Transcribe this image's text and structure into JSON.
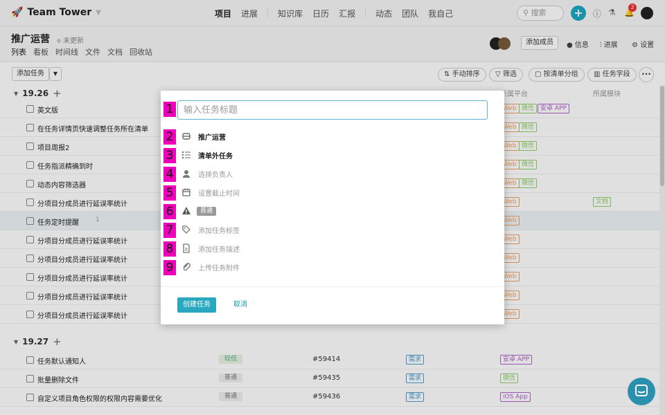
{
  "app": {
    "title": "Team Tower",
    "notif_count": "2"
  },
  "nav": {
    "items": [
      "项目",
      "进展",
      "知识库",
      "日历",
      "汇报",
      "动态",
      "团队",
      "我自己"
    ]
  },
  "search": {
    "placeholder": "搜索"
  },
  "project": {
    "title": "推广运营",
    "status": "未更新",
    "tabs": [
      "列表",
      "看板",
      "时间线",
      "文件",
      "文档",
      "回收站"
    ],
    "add_member": "添加成员",
    "info": "信息",
    "progress": "进展",
    "settings": "设置"
  },
  "toolbar": {
    "add_task": "添加任务",
    "sort": "手动排序",
    "filter": "筛选",
    "group": "按清单分组",
    "fields": "任务字段"
  },
  "columns": {
    "module": "所属模块",
    "platform": "所属平台"
  },
  "groups": [
    {
      "name": "19.26"
    },
    {
      "name": "19.27"
    }
  ],
  "rows1926": [
    {
      "title": "英文版",
      "tags": [
        "Web",
        "微信",
        "安卓 APP"
      ]
    },
    {
      "title": "在任务详情页快速调整任务所在清单",
      "tags": [
        "Web",
        "微信"
      ]
    },
    {
      "title": "项目周报2",
      "tags": [
        "Web",
        "微信"
      ]
    },
    {
      "title": "任务指派精确到时",
      "tags": [
        "Web",
        "微信"
      ]
    },
    {
      "title": "动态内容筛选器",
      "tags": [
        "Web",
        "微信"
      ]
    },
    {
      "title": "分项目分成员进行延误率统计",
      "tags": [
        "Web"
      ],
      "module": "文档"
    },
    {
      "title": "任务定时提醒",
      "tags": [
        "Web"
      ],
      "comments": "1"
    },
    {
      "title": "分项目分成员进行延误率统计",
      "tags": [
        "Web"
      ]
    },
    {
      "title": "分项目分成员进行延误率统计",
      "tags": [
        "Web"
      ]
    },
    {
      "title": "分项目分成员进行延误率统计",
      "tags": [
        "Web"
      ]
    },
    {
      "title": "分项目分成员进行延误率统计",
      "tags": [
        "Web"
      ]
    },
    {
      "title": "分项目分成员进行延误率统计",
      "tags": [
        "Web"
      ]
    }
  ],
  "rows1927": [
    {
      "title": "任务默认通知人",
      "priority": "较低",
      "id": "#59414",
      "type": "需求",
      "platform": "安卓 APP"
    },
    {
      "title": "批量删除文件",
      "priority": "普通",
      "id": "#59435",
      "type": "需求",
      "platform": "微信"
    },
    {
      "title": "自定义项目角色权限的权限内容需要优化",
      "priority": "普通",
      "id": "#59436",
      "type": "需求",
      "platform": "iOS App"
    }
  ],
  "modal": {
    "title_placeholder": "输入任务标题",
    "project": "推广运营",
    "list": "清单外任务",
    "assignee": "选择负责人",
    "deadline": "设置截止时间",
    "priority": "普通",
    "tags": "添加任务标签",
    "description": "添加任务描述",
    "attachment": "上传任务附件",
    "create": "创建任务",
    "cancel": "取消"
  },
  "markers": [
    "1",
    "2",
    "3",
    "4",
    "5",
    "6",
    "7",
    "8",
    "9"
  ],
  "colors": {
    "accent": "#1ba8c4",
    "marker": "#ee00bb",
    "web_tag": "#f0a060",
    "wechat_tag": "#8fcf6a",
    "app_tag": "#b060c8",
    "need_tag": "#4a9bd0"
  }
}
